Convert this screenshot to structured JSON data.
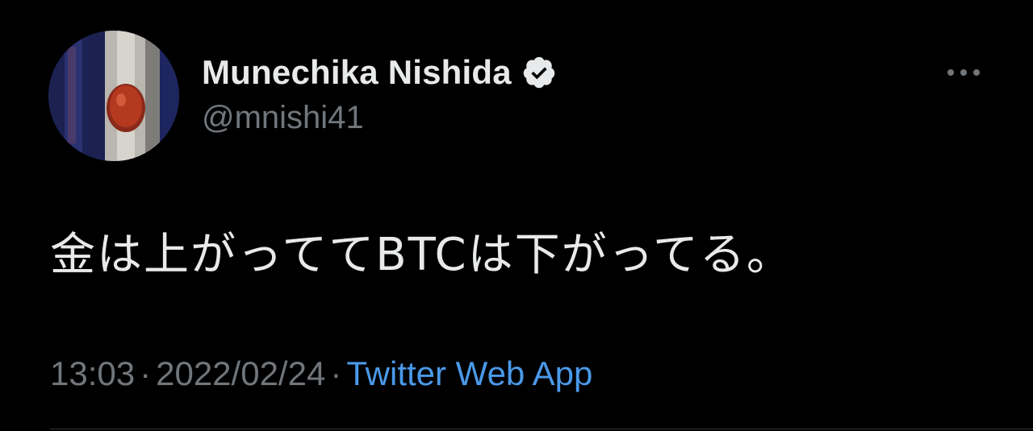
{
  "tweet": {
    "author": {
      "display_name": "Munechika Nishida",
      "handle": "@mnishi41",
      "verified": true,
      "verified_icon": "verified-badge-icon"
    },
    "text": "金は上がっててBTCは下がってる。",
    "time": "13:03",
    "separator": "·",
    "date": "2022/02/24",
    "source": "Twitter Web App",
    "more_icon": "more-options-icon"
  },
  "colors": {
    "background": "#000000",
    "primary_text": "#e7e9ea",
    "secondary_text": "#71767b",
    "link": "#4a99e9",
    "divider": "#2f3336"
  }
}
